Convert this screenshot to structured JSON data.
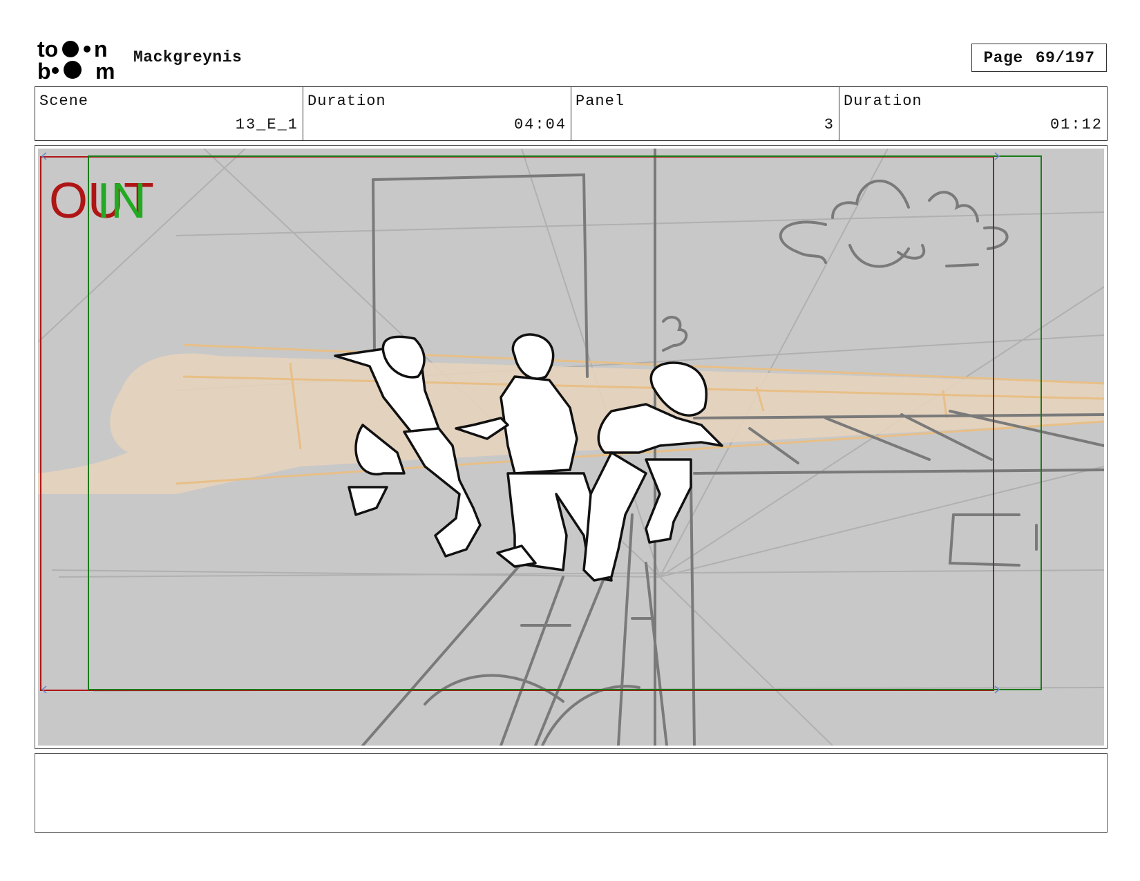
{
  "header": {
    "logo_text_top": "to",
    "logo_text_top_end": "n",
    "logo_text_bottom": "b",
    "logo_text_bottom_end": "m",
    "project_title": "Mackgreynis",
    "page_label": "Page",
    "page_number": "69/197"
  },
  "info": {
    "scene_label": "Scene",
    "scene_value": "13_E_1",
    "scene_duration_label": "Duration",
    "scene_duration_value": "04:04",
    "panel_label": "Panel",
    "panel_value": "3",
    "panel_duration_label": "Duration",
    "panel_duration_value": "01:12"
  },
  "panel": {
    "out_label": "OUT",
    "in_label": "IN",
    "colors": {
      "background": "#c8c8c8",
      "out_frame": "#b01515",
      "in_frame": "#1a7a1a",
      "in_text": "#22aa22",
      "out_text": "#b01515",
      "orange_beam": "#e8c9a0",
      "sketch_dark": "#111111",
      "sketch_grey": "#7a7a7a"
    }
  },
  "notes": {
    "text": ""
  }
}
